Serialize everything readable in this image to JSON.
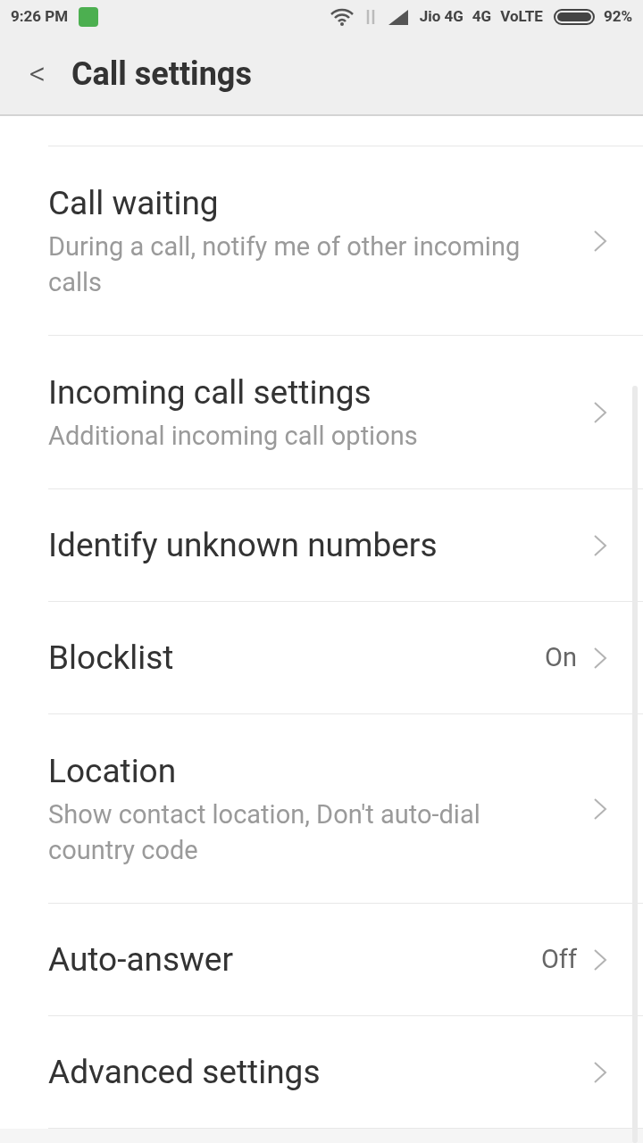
{
  "status_bar": {
    "time": "9:26 PM",
    "carrier": "Jio 4G",
    "network": "4G",
    "volte": "VoLTE",
    "battery": "92%"
  },
  "header": {
    "back": "<",
    "title": "Call settings"
  },
  "items": [
    {
      "title": "Call waiting",
      "subtitle": "During a call, notify me of other incoming calls"
    },
    {
      "title": "Incoming call settings",
      "subtitle": "Additional incoming call options"
    },
    {
      "title": "Identify unknown numbers"
    },
    {
      "title": "Blocklist",
      "value": "On"
    },
    {
      "title": "Location",
      "subtitle": "Show contact location, Don't auto-dial country code"
    },
    {
      "title": "Auto-answer",
      "value": "Off"
    },
    {
      "title": "Advanced settings"
    }
  ]
}
